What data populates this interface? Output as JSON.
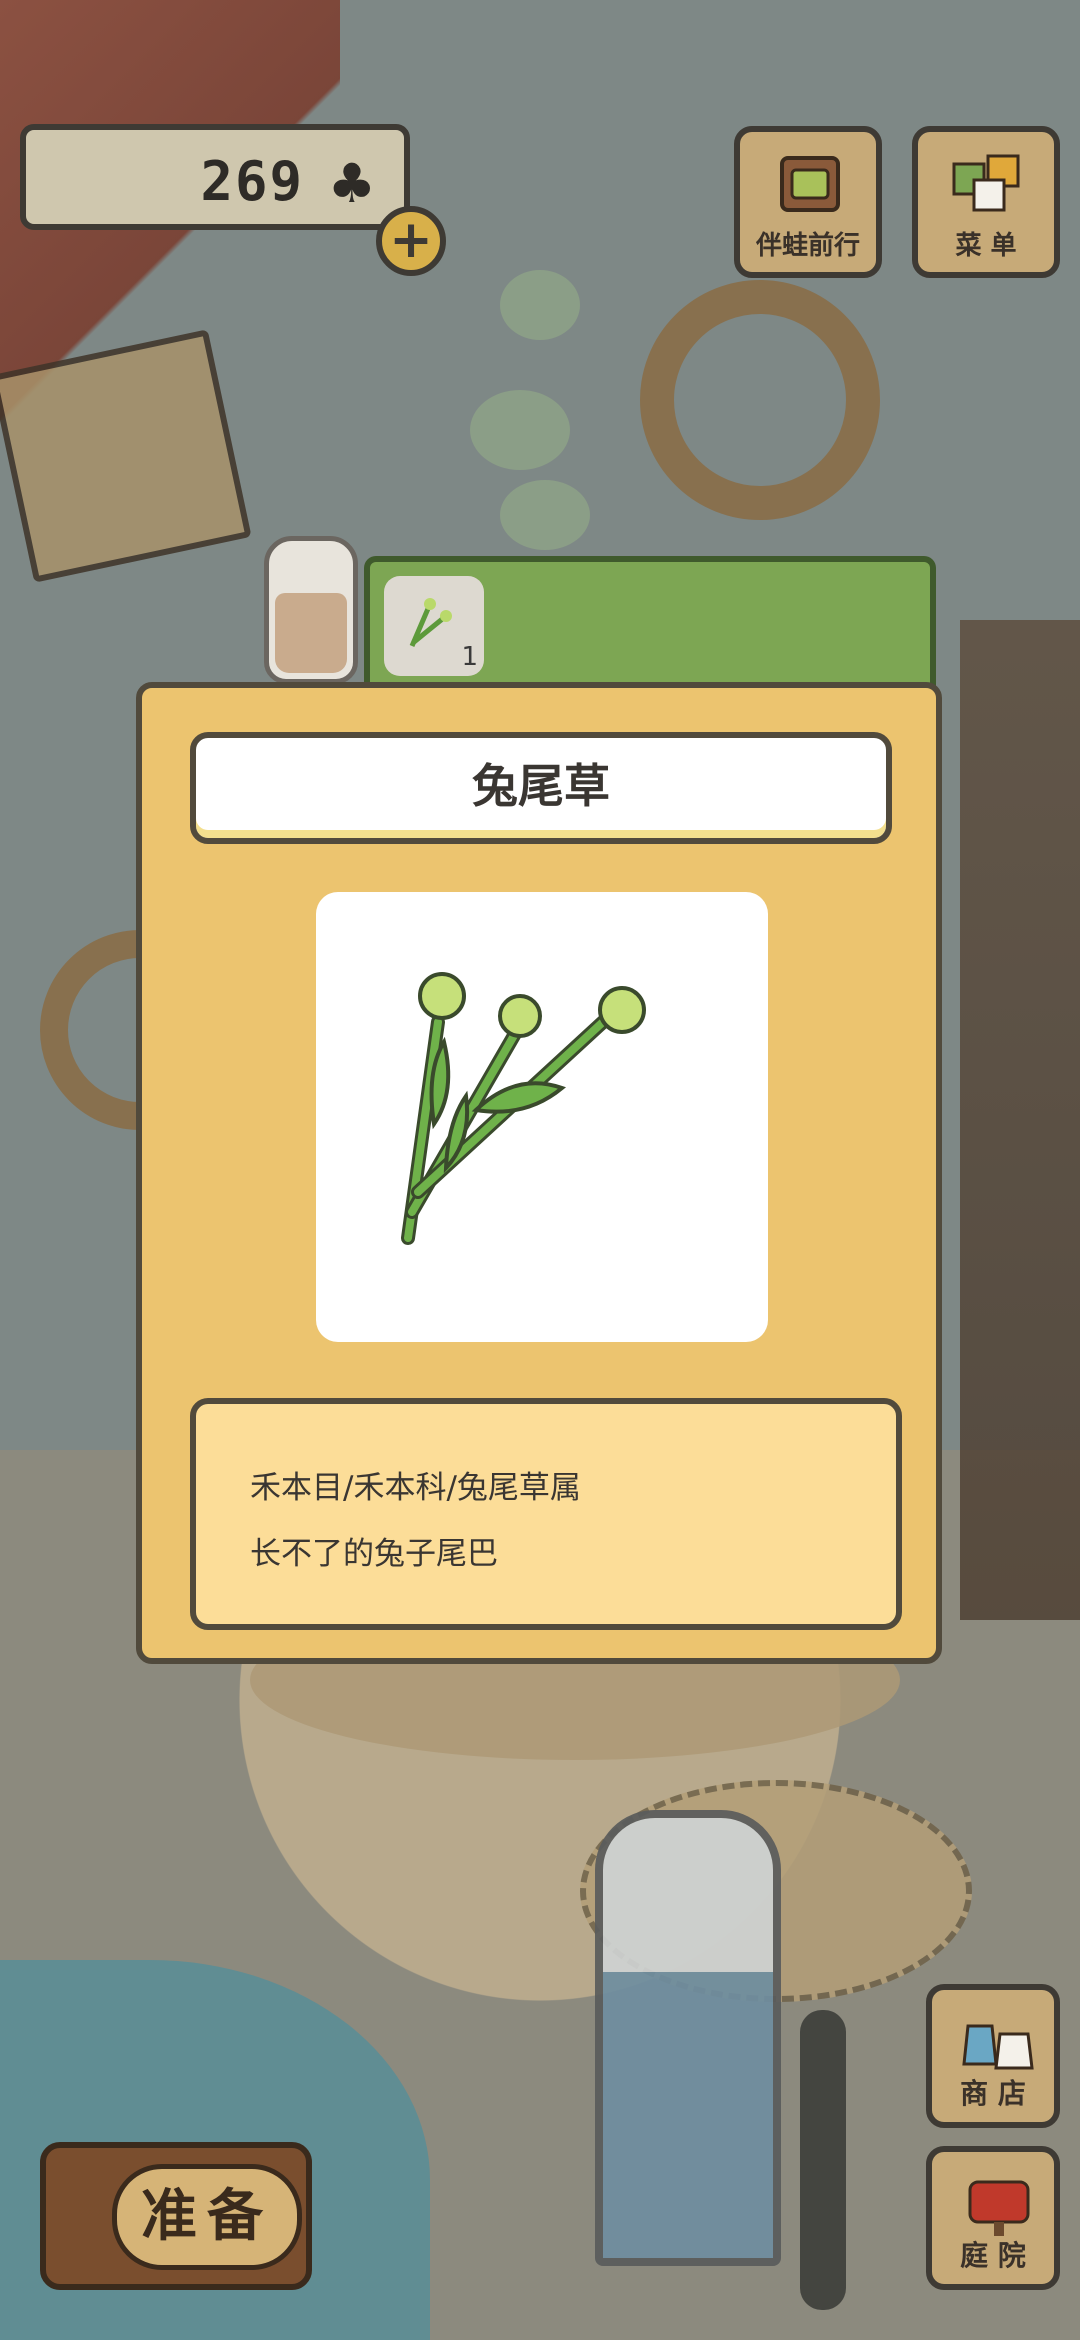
{
  "hud": {
    "clover_count": "269",
    "clover_icon": "♣",
    "plus_label": "+"
  },
  "top_buttons": [
    {
      "label": "伴蛙前行",
      "icon": "bag-icon"
    },
    {
      "label": "菜 单",
      "icon": "menu-icon"
    }
  ],
  "side_buttons": [
    {
      "label": "商 店",
      "icon": "shop-icon"
    },
    {
      "label": "庭 院",
      "icon": "mailbox-icon"
    }
  ],
  "ready_button": {
    "label": "准备"
  },
  "item_tab": {
    "selected_item_count": "1"
  },
  "dialog": {
    "title": "兔尾草",
    "taxonomy": "禾本目/禾本科/兔尾草属",
    "description": "长不了的兔子尾巴"
  },
  "colors": {
    "dialog_bg": "#ecc46f",
    "desc_bg": "#fcdd98",
    "tab_green": "#7da653"
  }
}
